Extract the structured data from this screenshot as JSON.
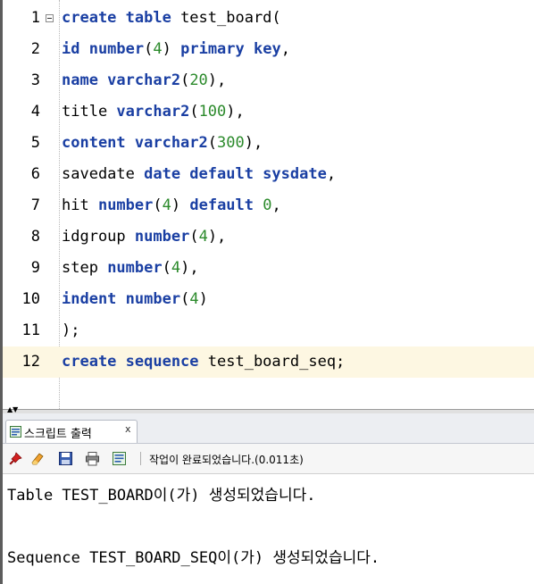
{
  "editor": {
    "current_line": 12,
    "lines": [
      {
        "no": "1",
        "tokens": [
          {
            "t": "create table",
            "k": "kw"
          },
          {
            "t": " test_board(",
            "k": ""
          }
        ]
      },
      {
        "no": "2",
        "tokens": [
          {
            "t": "id number",
            "k": "kw"
          },
          {
            "t": "(",
            "k": ""
          },
          {
            "t": "4",
            "k": "num"
          },
          {
            "t": ") ",
            "k": ""
          },
          {
            "t": "primary key",
            "k": "kw"
          },
          {
            "t": ",",
            "k": ""
          }
        ]
      },
      {
        "no": "3",
        "tokens": [
          {
            "t": "name varchar2",
            "k": "kw"
          },
          {
            "t": "(",
            "k": ""
          },
          {
            "t": "20",
            "k": "num"
          },
          {
            "t": "),",
            "k": ""
          }
        ]
      },
      {
        "no": "4",
        "tokens": [
          {
            "t": "title ",
            "k": ""
          },
          {
            "t": "varchar2",
            "k": "kw"
          },
          {
            "t": "(",
            "k": ""
          },
          {
            "t": "100",
            "k": "num"
          },
          {
            "t": "),",
            "k": ""
          }
        ]
      },
      {
        "no": "5",
        "tokens": [
          {
            "t": "content varchar2",
            "k": "kw"
          },
          {
            "t": "(",
            "k": ""
          },
          {
            "t": "300",
            "k": "num"
          },
          {
            "t": "),",
            "k": ""
          }
        ]
      },
      {
        "no": "6",
        "tokens": [
          {
            "t": "savedate ",
            "k": ""
          },
          {
            "t": "date default sysdate",
            "k": "kw"
          },
          {
            "t": ",",
            "k": ""
          }
        ]
      },
      {
        "no": "7",
        "tokens": [
          {
            "t": "hit ",
            "k": ""
          },
          {
            "t": "number",
            "k": "kw"
          },
          {
            "t": "(",
            "k": ""
          },
          {
            "t": "4",
            "k": "num"
          },
          {
            "t": ") ",
            "k": ""
          },
          {
            "t": "default",
            "k": "kw"
          },
          {
            "t": " ",
            "k": ""
          },
          {
            "t": "0",
            "k": "num"
          },
          {
            "t": ",",
            "k": ""
          }
        ]
      },
      {
        "no": "8",
        "tokens": [
          {
            "t": "idgroup ",
            "k": ""
          },
          {
            "t": "number",
            "k": "kw"
          },
          {
            "t": "(",
            "k": ""
          },
          {
            "t": "4",
            "k": "num"
          },
          {
            "t": "),",
            "k": ""
          }
        ]
      },
      {
        "no": "9",
        "tokens": [
          {
            "t": "step ",
            "k": ""
          },
          {
            "t": "number",
            "k": "kw"
          },
          {
            "t": "(",
            "k": ""
          },
          {
            "t": "4",
            "k": "num"
          },
          {
            "t": "),",
            "k": ""
          }
        ]
      },
      {
        "no": "10",
        "tokens": [
          {
            "t": "indent number",
            "k": "kw"
          },
          {
            "t": "(",
            "k": ""
          },
          {
            "t": "4",
            "k": "num"
          },
          {
            "t": ")",
            "k": ""
          }
        ]
      },
      {
        "no": "11",
        "tokens": [
          {
            "t": ");",
            "k": ""
          }
        ]
      },
      {
        "no": "12",
        "tokens": [
          {
            "t": "create sequence",
            "k": "kw"
          },
          {
            "t": " test_board_seq;",
            "k": ""
          }
        ]
      }
    ]
  },
  "output_panel": {
    "tab_label": "스크립트 출력",
    "tab_close": "x",
    "status_text": "작업이 완료되었습니다.(0.011초)",
    "toolbar_icons": [
      "pin-icon",
      "eraser-icon",
      "save-icon",
      "print-icon",
      "script-icon"
    ],
    "lines": [
      "Table TEST_BOARD이(가) 생성되었습니다.",
      "",
      "Sequence TEST_BOARD_SEQ이(가) 생성되었습니다."
    ]
  },
  "colors": {
    "keyword": "#1a3fa3",
    "number": "#2b8a2b",
    "current_line_bg": "#fdf7e2"
  }
}
